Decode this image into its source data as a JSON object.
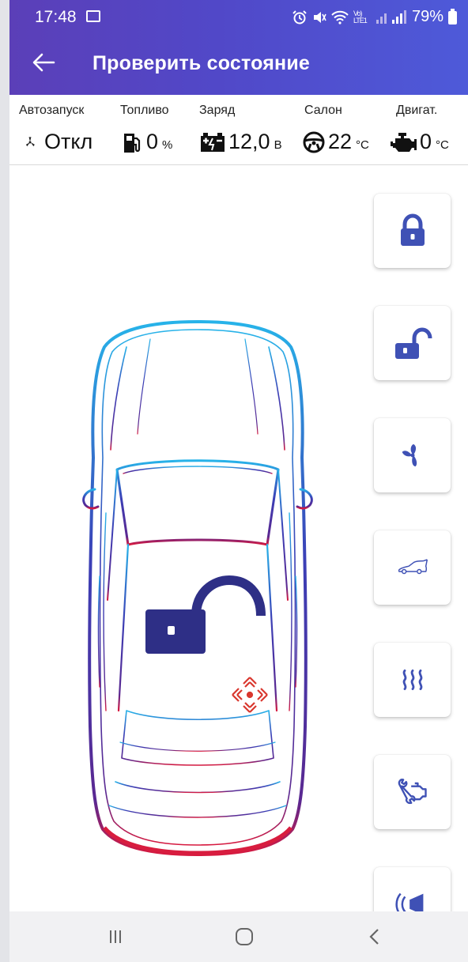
{
  "status_bar": {
    "time": "17:48",
    "network_label": "Vo) LTE1",
    "battery": "79%"
  },
  "app_bar": {
    "title": "Проверить состояние",
    "back_icon": "arrow-left-icon"
  },
  "parameters": [
    {
      "label": "Автозапуск",
      "value": "Откл",
      "unit": "",
      "icon": "autostart-fan-icon"
    },
    {
      "label": "Топливо",
      "value": "0",
      "unit": "%",
      "icon": "fuel-pump-icon"
    },
    {
      "label": "Заряд",
      "value": "12,0",
      "unit": "В",
      "icon": "car-battery-icon"
    },
    {
      "label": "Салон",
      "value": "22",
      "unit": "°С",
      "icon": "steering-wheel-icon"
    },
    {
      "label": "Двигат.",
      "value": "0",
      "unit": "°С",
      "icon": "engine-icon"
    }
  ],
  "car_status": {
    "lock_state_icon": "unlocked-padlock-icon",
    "sensor_icon": "shock-sensor-icon"
  },
  "controls": [
    {
      "name": "lock-button",
      "icon": "locked-padlock-icon"
    },
    {
      "name": "unlock-button",
      "icon": "unlocked-padlock-icon"
    },
    {
      "name": "autostart-button",
      "icon": "fan-icon"
    },
    {
      "name": "trunk-button",
      "icon": "car-trunk-icon"
    },
    {
      "name": "heater-button",
      "icon": "heat-waves-icon"
    },
    {
      "name": "service-button",
      "icon": "wrench-engine-icon"
    },
    {
      "name": "horn-button",
      "icon": "horn-icon"
    }
  ],
  "colors": {
    "accent": "#3f51b5",
    "lock_dark": "#2e2f86",
    "sensor_red": "#d9372e",
    "appbar_start": "#5b3fb8",
    "appbar_end": "#4e5ad9"
  }
}
